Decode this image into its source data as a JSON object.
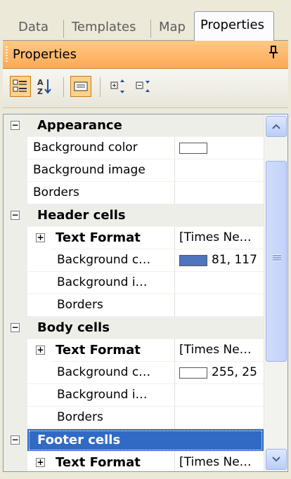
{
  "tabs": [
    {
      "label": "Data",
      "active": false
    },
    {
      "label": "Templates",
      "active": false
    },
    {
      "label": "Map",
      "active": false
    },
    {
      "label": "Properties",
      "active": true
    }
  ],
  "panel": {
    "title": "Properties",
    "pin_icon": "pin-icon"
  },
  "toolbar": {
    "buttons": [
      {
        "icon": "categorized-icon",
        "active": true
      },
      {
        "icon": "alphabetical-sort-icon",
        "active": false
      },
      {
        "icon": "property-pages-icon",
        "active": true
      },
      {
        "icon": "expand-all-icon",
        "active": false
      },
      {
        "icon": "collapse-all-icon",
        "active": false
      }
    ]
  },
  "colors": {
    "accent": "#316ac5",
    "titlebar": "#fcb66e",
    "header_swatch": "#4f75bf",
    "body_swatch": "#ffffff"
  },
  "grid": {
    "appearance": {
      "label": "Appearance",
      "expander": "−",
      "rows": [
        {
          "name": "Background color",
          "value": ""
        },
        {
          "name": "Background image",
          "value": ""
        },
        {
          "name": "Borders",
          "value": ""
        }
      ]
    },
    "header": {
      "label": "Header cells",
      "expander": "−",
      "text_format": {
        "name": "Text Format",
        "value": "[Times Ne…",
        "expander": "+"
      },
      "rows": [
        {
          "name": "Background c…",
          "value": "81, 117"
        },
        {
          "name": "Background i…",
          "value": ""
        },
        {
          "name": "Borders",
          "value": ""
        }
      ]
    },
    "body": {
      "label": "Body cells",
      "expander": "−",
      "text_format": {
        "name": "Text Format",
        "value": "[Times Ne…",
        "expander": "+"
      },
      "rows": [
        {
          "name": "Background c…",
          "value": "255, 25"
        },
        {
          "name": "Background i…",
          "value": ""
        },
        {
          "name": "Borders",
          "value": ""
        }
      ]
    },
    "footer": {
      "label": "Footer cells",
      "expander": "−",
      "text_format": {
        "name": "Text Format",
        "value": "[Times Ne…",
        "expander": "+"
      }
    }
  }
}
